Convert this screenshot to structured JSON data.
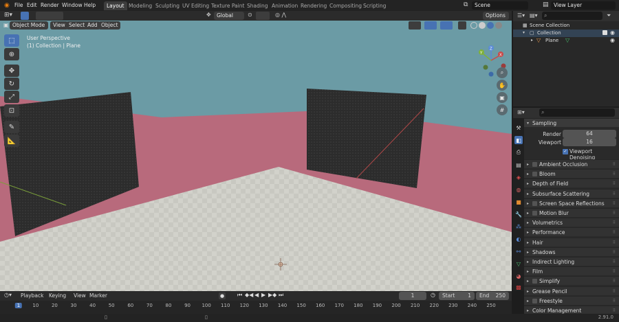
{
  "topbar": {
    "menus": [
      "File",
      "Edit",
      "Render",
      "Window",
      "Help"
    ],
    "workspaces": [
      "Layout",
      "Modeling",
      "Sculpting",
      "UV Editing",
      "Texture Paint",
      "Shading",
      "Animation",
      "Rendering",
      "Compositing",
      "Scripting"
    ],
    "active_workspace": "Layout",
    "scene": "Scene",
    "view_layer": "View Layer"
  },
  "viewport": {
    "mode": "Object Mode",
    "menus": [
      "View",
      "Select",
      "Add",
      "Object"
    ],
    "orientation": "Global",
    "options": "Options",
    "info_line1": "User Perspective",
    "info_line2": "(1) Collection | Plane",
    "gizmo_axes": [
      "Z",
      "Y",
      "X"
    ],
    "colors": {
      "sky": "#6b9ba5",
      "wall": "#b86a7c",
      "floor": "#c9c9c3",
      "panel": "#2c2c2c",
      "accent": "#4772b3"
    }
  },
  "outliner": {
    "scene_collection": "Scene Collection",
    "collection": "Collection",
    "object": "Plane"
  },
  "properties": {
    "section": "Sampling",
    "render_label": "Render",
    "render_value": "64",
    "viewport_label": "Viewport",
    "viewport_value": "16",
    "denoise_label": "Viewport Denoising",
    "panels": [
      {
        "label": "Ambient Occlusion",
        "checkbox": true
      },
      {
        "label": "Bloom",
        "checkbox": true
      },
      {
        "label": "Depth of Field",
        "checkbox": false
      },
      {
        "label": "Subsurface Scattering",
        "checkbox": false
      },
      {
        "label": "Screen Space Reflections",
        "checkbox": true
      },
      {
        "label": "Motion Blur",
        "checkbox": true
      },
      {
        "label": "Volumetrics",
        "checkbox": false
      },
      {
        "label": "Performance",
        "checkbox": false
      },
      {
        "label": "Hair",
        "checkbox": false
      },
      {
        "label": "Shadows",
        "checkbox": false
      },
      {
        "label": "Indirect Lighting",
        "checkbox": false
      },
      {
        "label": "Film",
        "checkbox": false
      },
      {
        "label": "Simplify",
        "checkbox": true
      },
      {
        "label": "Grease Pencil",
        "checkbox": false
      },
      {
        "label": "Freestyle",
        "checkbox": true
      },
      {
        "label": "Color Management",
        "checkbox": false
      }
    ]
  },
  "timeline": {
    "menus": [
      "Playback",
      "Keying",
      "View",
      "Marker"
    ],
    "current_frame": "1",
    "start_label": "Start",
    "start": "1",
    "end_label": "End",
    "end": "250",
    "ticks": [
      "1",
      "10",
      "20",
      "30",
      "40",
      "50",
      "60",
      "70",
      "80",
      "90",
      "100",
      "110",
      "120",
      "130",
      "140",
      "150",
      "160",
      "170",
      "180",
      "190",
      "200",
      "210",
      "220",
      "230",
      "240",
      "250"
    ]
  },
  "status": {
    "version": "2.91.0"
  }
}
